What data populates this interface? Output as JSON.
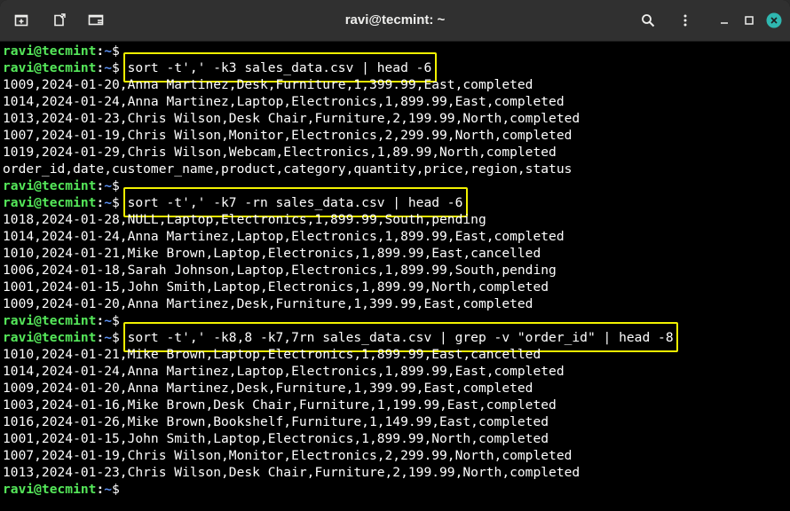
{
  "window": {
    "title": "ravi@tecmint: ~",
    "icons": [
      "new-tab-icon",
      "detach-tab-icon",
      "screen-icon",
      "search-icon",
      "menu-icon",
      "minimize-icon",
      "maximize-icon",
      "close-icon"
    ],
    "close_color": "#2fb7b0"
  },
  "prompt": {
    "user": "ravi@tecmint",
    "sep": ":",
    "path": "~",
    "dollar": "$"
  },
  "lines": [
    {
      "type": "prompt",
      "cmd": ""
    },
    {
      "type": "prompt",
      "cmd": "sort -t',' -k3 sales_data.csv | head -6",
      "highlight": true
    },
    {
      "type": "out",
      "text": "1009,2024-01-20,Anna Martinez,Desk,Furniture,1,399.99,East,completed"
    },
    {
      "type": "out",
      "text": "1014,2024-01-24,Anna Martinez,Laptop,Electronics,1,899.99,East,completed"
    },
    {
      "type": "out",
      "text": "1013,2024-01-23,Chris Wilson,Desk Chair,Furniture,2,199.99,North,completed"
    },
    {
      "type": "out",
      "text": "1007,2024-01-19,Chris Wilson,Monitor,Electronics,2,299.99,North,completed"
    },
    {
      "type": "out",
      "text": "1019,2024-01-29,Chris Wilson,Webcam,Electronics,1,89.99,North,completed"
    },
    {
      "type": "out",
      "text": "order_id,date,customer_name,product,category,quantity,price,region,status"
    },
    {
      "type": "prompt",
      "cmd": ""
    },
    {
      "type": "prompt",
      "cmd": "sort -t',' -k7 -rn sales_data.csv | head -6",
      "highlight": true
    },
    {
      "type": "out",
      "text": "1018,2024-01-28,NULL,Laptop,Electronics,1,899.99,South,pending"
    },
    {
      "type": "out",
      "text": "1014,2024-01-24,Anna Martinez,Laptop,Electronics,1,899.99,East,completed"
    },
    {
      "type": "out",
      "text": "1010,2024-01-21,Mike Brown,Laptop,Electronics,1,899.99,East,cancelled"
    },
    {
      "type": "out",
      "text": "1006,2024-01-18,Sarah Johnson,Laptop,Electronics,1,899.99,South,pending"
    },
    {
      "type": "out",
      "text": "1001,2024-01-15,John Smith,Laptop,Electronics,1,899.99,North,completed"
    },
    {
      "type": "out",
      "text": "1009,2024-01-20,Anna Martinez,Desk,Furniture,1,399.99,East,completed"
    },
    {
      "type": "prompt",
      "cmd": ""
    },
    {
      "type": "prompt",
      "cmd": "sort -t',' -k8,8 -k7,7rn sales_data.csv | grep -v \"order_id\" | head -8",
      "highlight": true
    },
    {
      "type": "out",
      "text": "1010,2024-01-21,Mike Brown,Laptop,Electronics,1,899.99,East,cancelled"
    },
    {
      "type": "out",
      "text": "1014,2024-01-24,Anna Martinez,Laptop,Electronics,1,899.99,East,completed"
    },
    {
      "type": "out",
      "text": "1009,2024-01-20,Anna Martinez,Desk,Furniture,1,399.99,East,completed"
    },
    {
      "type": "out",
      "text": "1003,2024-01-16,Mike Brown,Desk Chair,Furniture,1,199.99,East,completed"
    },
    {
      "type": "out",
      "text": "1016,2024-01-26,Mike Brown,Bookshelf,Furniture,1,149.99,East,completed"
    },
    {
      "type": "out",
      "text": "1001,2024-01-15,John Smith,Laptop,Electronics,1,899.99,North,completed"
    },
    {
      "type": "out",
      "text": "1007,2024-01-19,Chris Wilson,Monitor,Electronics,2,299.99,North,completed"
    },
    {
      "type": "out",
      "text": "1013,2024-01-23,Chris Wilson,Desk Chair,Furniture,2,199.99,North,completed"
    },
    {
      "type": "prompt",
      "cmd": ""
    }
  ],
  "colors": {
    "prompt_user": "#55e85a",
    "prompt_path": "#5b8ff0",
    "highlight": "#f2f200",
    "background": "#000000"
  }
}
